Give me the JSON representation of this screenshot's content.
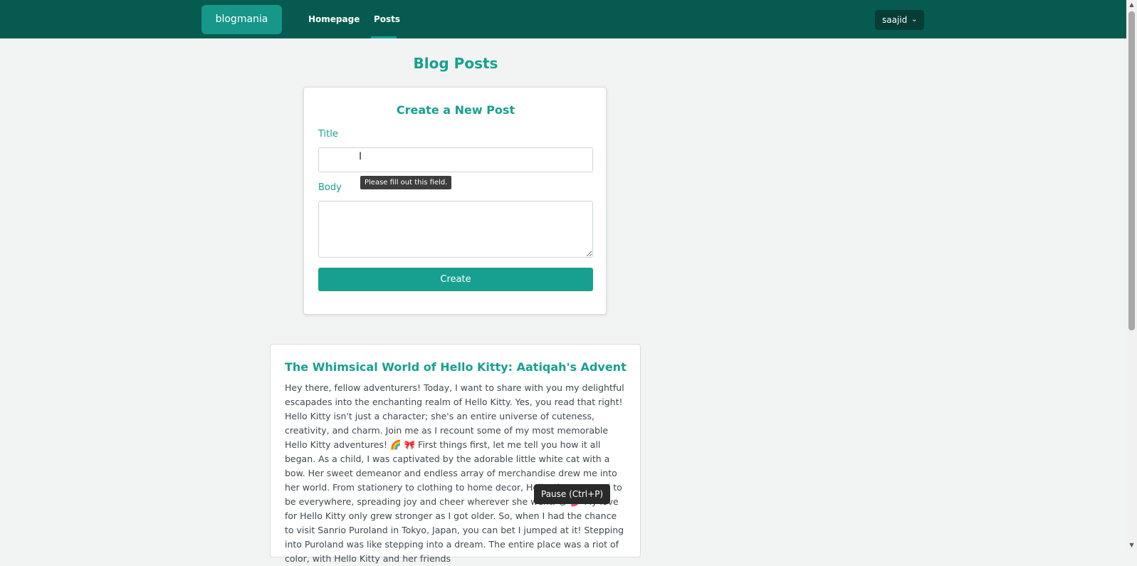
{
  "navbar": {
    "brand": "blogmania",
    "links": [
      {
        "label": "Homepage"
      },
      {
        "label": "Posts"
      }
    ],
    "user": "saajid"
  },
  "page": {
    "title": "Blog Posts"
  },
  "form": {
    "heading": "Create a New Post",
    "title_label": "Title",
    "title_value": "",
    "body_label": "Body",
    "body_value": "",
    "submit_label": "Create",
    "validation_message": "Please fill out this field."
  },
  "posts": [
    {
      "title": "The Whimsical World of Hello Kitty: Aatiqah's Adventures",
      "body": "Hey there, fellow adventurers! Today, I want to share with you my delightful escapades into the enchanting realm of Hello Kitty. Yes, you read that right! Hello Kitty isn't just a character; she's an entire universe of cuteness, creativity, and charm. Join me as I recount some of my most memorable Hello Kitty adventures! 🌈 🎀 First things first, let me tell you how it all began. As a child, I was captivated by the adorable little white cat with a bow. Her sweet demeanor and endless array of merchandise drew me into her world. From stationery to clothing to home decor, Hello Kitty seemed to be everywhere, spreading joy and cheer wherever she went. 😺 💕 My love for Hello Kitty only grew stronger as I got older. So, when I had the chance to visit Sanrio Puroland in Tokyo, Japan, you can bet I jumped at it! Stepping into Puroland was like stepping into a dream. The entire place was a riot of color, with Hello Kitty and her friends"
    }
  ],
  "tooltip": {
    "media": "Pause (Ctrl+P)"
  },
  "icons": {
    "chevron": "chevron-down-icon",
    "cursor": "text-cursor-icon"
  },
  "colors": {
    "navbar": "#075a4f",
    "accent": "#17a08f",
    "brand_bg": "#16978a",
    "background": "#f2f4f4"
  }
}
